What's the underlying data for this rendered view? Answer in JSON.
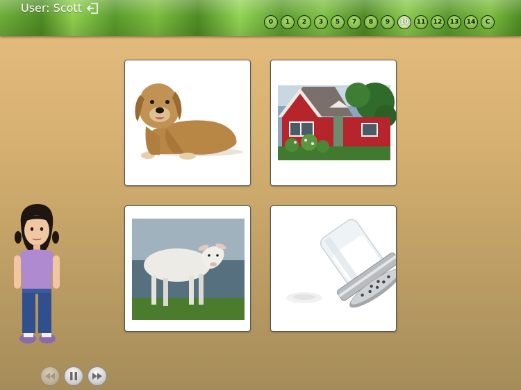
{
  "header": {
    "user_label": "User: Scott",
    "levels": [
      "0",
      "1",
      "2",
      "3",
      "5",
      "7",
      "8",
      "9",
      "10",
      "11",
      "12",
      "13",
      "14",
      "C"
    ],
    "active_level": "10"
  },
  "cards": [
    {
      "name": "dog",
      "icon": "dog-picture"
    },
    {
      "name": "house",
      "icon": "red-house-picture"
    },
    {
      "name": "sheep",
      "icon": "lamb-picture"
    },
    {
      "name": "salt",
      "icon": "salt-shaker-picture"
    }
  ],
  "controls": {
    "rewind": "rewind-icon",
    "pause": "pause-icon",
    "forward": "fast-forward-icon"
  },
  "colors": {
    "accent_green": "#6fae3a",
    "background": "#d7b171"
  }
}
